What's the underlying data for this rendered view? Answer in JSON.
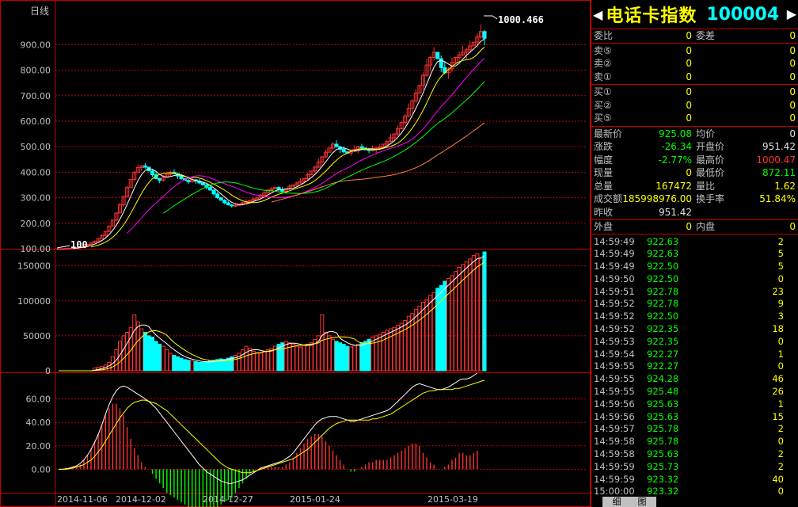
{
  "chart": {
    "period_label": "日线",
    "price_ticks": [
      "900.00",
      "800.00",
      "700.00",
      "600.00",
      "500.00",
      "400.00",
      "300.00",
      "200.00",
      "100.00"
    ],
    "volume_ticks": [
      "150000",
      "100000",
      "50000",
      "0"
    ],
    "macd_ticks": [
      "60.00",
      "40.00",
      "20.00",
      "0.00"
    ],
    "date_labels": [
      "2014-11-06",
      "2014-12-02",
      "2014-12-27",
      "2015-01-24",
      "2015-03-19"
    ],
    "high_marker": "1000.466",
    "low_marker": "100",
    "colors": {
      "up": "#ff3232",
      "down": "#00ffff",
      "grid": "#c00000",
      "ma5": "#ffffff",
      "ma10": "#ffff00",
      "ma20": "#ff00ff",
      "ma30": "#00ff00",
      "ma60": "#ff8040",
      "macd_pos": "#ff3232",
      "macd_neg": "#00ff00"
    }
  },
  "chart_data": {
    "type": "candlestick",
    "title": "电话卡指数 100004",
    "period": "日线",
    "price_axis": {
      "ylim": [
        100,
        1000.466
      ],
      "ticks": [
        100,
        200,
        300,
        400,
        500,
        600,
        700,
        800,
        900
      ]
    },
    "volume_axis": {
      "ylim": [
        0,
        170000
      ],
      "ticks": [
        0,
        50000,
        100000,
        150000
      ]
    },
    "macd_axis": {
      "ylim": [
        -20,
        80
      ],
      "ticks": [
        0,
        20,
        40,
        60
      ]
    },
    "close": [
      100,
      100,
      101,
      102,
      103,
      105,
      108,
      112,
      117,
      123,
      130,
      140,
      152,
      168,
      188,
      212,
      240,
      272,
      305,
      340,
      372,
      400,
      418,
      425,
      420,
      405,
      390,
      375,
      368,
      380,
      392,
      400,
      395,
      385,
      375,
      368,
      362,
      370,
      365,
      358,
      350,
      340,
      330,
      315,
      300,
      290,
      280,
      272,
      268,
      270,
      275,
      280,
      285,
      290,
      295,
      300,
      310,
      320,
      330,
      335,
      340,
      332,
      325,
      335,
      345,
      350,
      358,
      365,
      375,
      390,
      405,
      420,
      440,
      460,
      478,
      495,
      510,
      500,
      490,
      480,
      475,
      482,
      490,
      500,
      495,
      488,
      485,
      490,
      495,
      500,
      510,
      520,
      535,
      550,
      570,
      595,
      620,
      650,
      680,
      710,
      740,
      780,
      820,
      850,
      870,
      845,
      810,
      790,
      805,
      830,
      850,
      860,
      870,
      880,
      895,
      910,
      930,
      951.42,
      925.08
    ],
    "volume": [
      0,
      0,
      0,
      0,
      0,
      0,
      0,
      0,
      0,
      0,
      4000,
      5000,
      6000,
      8000,
      12000,
      20000,
      30000,
      42000,
      50000,
      55000,
      62000,
      80000,
      70000,
      60000,
      55000,
      50000,
      48000,
      42000,
      38000,
      35000,
      30000,
      25000,
      22000,
      20000,
      18000,
      16000,
      15000,
      14000,
      13000,
      12000,
      12000,
      13000,
      14000,
      15000,
      16000,
      17000,
      16000,
      18000,
      20000,
      22000,
      25000,
      30000,
      35000,
      32000,
      28000,
      26000,
      25000,
      28000,
      30000,
      32000,
      35000,
      38000,
      40000,
      42000,
      40000,
      38000,
      35000,
      34000,
      36000,
      38000,
      40000,
      45000,
      50000,
      80000,
      55000,
      50000,
      45000,
      42000,
      40000,
      38000,
      35000,
      34000,
      36000,
      38000,
      40000,
      42000,
      45000,
      48000,
      50000,
      52000,
      55000,
      58000,
      60000,
      62000,
      65000,
      68000,
      72000,
      78000,
      82000,
      88000,
      92000,
      98000,
      102000,
      108000,
      112000,
      118000,
      122000,
      128000,
      132000,
      136000,
      142000,
      148000,
      152000,
      156000,
      160000,
      165000,
      167472,
      160000,
      170000
    ],
    "dif": [
      0,
      0,
      0.5,
      1,
      2,
      3,
      5,
      8,
      12,
      17,
      23,
      30,
      38,
      47,
      55,
      62,
      67,
      70,
      71,
      70,
      68,
      66,
      64,
      62,
      60,
      58,
      55,
      52,
      48,
      44,
      40,
      36,
      32,
      28,
      24,
      20,
      16,
      12,
      8,
      4,
      1,
      -2,
      -4,
      -6,
      -8,
      -10,
      -11,
      -12,
      -12,
      -11,
      -10,
      -9,
      -7,
      -5,
      -3,
      -1,
      1,
      2,
      3,
      4,
      5,
      6,
      7,
      9,
      11,
      14,
      18,
      22,
      26,
      30,
      34,
      38,
      41,
      43,
      44,
      45,
      45,
      45,
      44,
      43,
      42,
      41,
      41,
      42,
      43,
      44,
      45,
      46,
      47,
      48,
      49,
      50,
      52,
      55,
      58,
      61,
      64,
      67,
      70,
      72,
      73,
      72,
      71,
      70,
      69,
      68,
      68,
      69,
      70,
      72,
      74,
      76,
      77,
      77,
      78,
      80,
      82
    ],
    "dea": [
      0,
      0,
      0,
      0.5,
      1,
      2,
      3,
      4,
      6,
      8,
      11,
      15,
      19,
      24,
      29,
      34,
      39,
      44,
      48,
      52,
      55,
      57,
      58,
      59,
      59,
      58,
      57,
      56,
      54,
      52,
      50,
      47,
      44,
      41,
      38,
      35,
      32,
      29,
      26,
      23,
      20,
      17,
      14,
      11,
      8,
      5,
      3,
      1,
      0,
      -1,
      -2,
      -3,
      -3,
      -3,
      -2,
      -1,
      0,
      1,
      2,
      3,
      4,
      5,
      6,
      7,
      8,
      9,
      11,
      13,
      15,
      17,
      20,
      23,
      26,
      29,
      32,
      35,
      37,
      39,
      40,
      41,
      42,
      42,
      42,
      42,
      42,
      42,
      42,
      43,
      43,
      44,
      45,
      46,
      47,
      49,
      51,
      53,
      55,
      57,
      59,
      61,
      63,
      65,
      66,
      67,
      67,
      68,
      68,
      68,
      68,
      68,
      69,
      69,
      70,
      71,
      72,
      73,
      74,
      75,
      76,
      77
    ]
  },
  "side": {
    "title_left_arrow": "◀",
    "title_name": "电话卡指数",
    "title_code": "100004",
    "title_right_arrow": "▶",
    "wb": {
      "l1": "委比",
      "v1": "0",
      "l2": "委差",
      "v2": "0"
    },
    "sells": [
      {
        "label": "卖⑤",
        "price": "0",
        "vol": "0"
      },
      {
        "label": "卖②",
        "price": "0",
        "vol": "0"
      },
      {
        "label": "卖①",
        "price": "0",
        "vol": "0"
      }
    ],
    "buys": [
      {
        "label": "买①",
        "price": "0",
        "vol": "0"
      },
      {
        "label": "买②",
        "price": "0",
        "vol": "0"
      },
      {
        "label": "买⑤",
        "price": "0",
        "vol": "0"
      }
    ],
    "quote": [
      {
        "l1": "最新价",
        "v1": "925.08",
        "c1": "grn",
        "l2": "均价",
        "v2": "0",
        "c2": "wht"
      },
      {
        "l1": "涨跌",
        "v1": "-26.34",
        "c1": "grn",
        "l2": "开盘价",
        "v2": "951.42",
        "c2": "wht"
      },
      {
        "l1": "幅度",
        "v1": "-2.77%",
        "c1": "grn",
        "l2": "最高价",
        "v2": "1000.47",
        "c2": "red"
      },
      {
        "l1": "现量",
        "v1": "0",
        "c1": "yel",
        "l2": "最低价",
        "v2": "872.11",
        "c2": "grn"
      },
      {
        "l1": "总量",
        "v1": "167472",
        "c1": "yel",
        "l2": "量比",
        "v2": "1.62",
        "c2": "yel"
      },
      {
        "l1": "成交额",
        "v1": "185998976.00",
        "c1": "yel",
        "l2": "换手率",
        "v2": "51.84%",
        "c2": "yel"
      },
      {
        "l1": "昨收",
        "v1": "951.42",
        "c1": "wht",
        "l2": "",
        "v2": "",
        "c2": "wht"
      }
    ],
    "outin": {
      "l1": "外盘",
      "v1": "0",
      "l2": "内盘",
      "v2": "0"
    },
    "ticks": [
      {
        "t": "14:59:49",
        "p": "922.63",
        "v": "2"
      },
      {
        "t": "14:59:49",
        "p": "922.63",
        "v": "5"
      },
      {
        "t": "14:59:49",
        "p": "922.50",
        "v": "5"
      },
      {
        "t": "14:59:50",
        "p": "922.50",
        "v": "0"
      },
      {
        "t": "14:59:51",
        "p": "922.78",
        "v": "23"
      },
      {
        "t": "14:59:52",
        "p": "922.78",
        "v": "9"
      },
      {
        "t": "14:59:52",
        "p": "922.50",
        "v": "3"
      },
      {
        "t": "14:59:52",
        "p": "922.35",
        "v": "18"
      },
      {
        "t": "14:59:53",
        "p": "922.35",
        "v": "0"
      },
      {
        "t": "14:59:54",
        "p": "922.27",
        "v": "1"
      },
      {
        "t": "14:59:55",
        "p": "922.27",
        "v": "0"
      },
      {
        "t": "14:59:55",
        "p": "924.28",
        "v": "46"
      },
      {
        "t": "14:59:55",
        "p": "925.48",
        "v": "26"
      },
      {
        "t": "14:59:56",
        "p": "925.63",
        "v": "1"
      },
      {
        "t": "14:59:56",
        "p": "925.63",
        "v": "15"
      },
      {
        "t": "14:59:57",
        "p": "925.78",
        "v": "2"
      },
      {
        "t": "14:59:58",
        "p": "925.78",
        "v": "0"
      },
      {
        "t": "14:59:58",
        "p": "925.63",
        "v": "2"
      },
      {
        "t": "14:59:59",
        "p": "925.73",
        "v": "2"
      },
      {
        "t": "14:59:59",
        "p": "923.32",
        "v": "40"
      },
      {
        "t": "15:00:00",
        "p": "923.32",
        "v": "0"
      }
    ],
    "tab1": "细",
    "tab2": "图"
  }
}
